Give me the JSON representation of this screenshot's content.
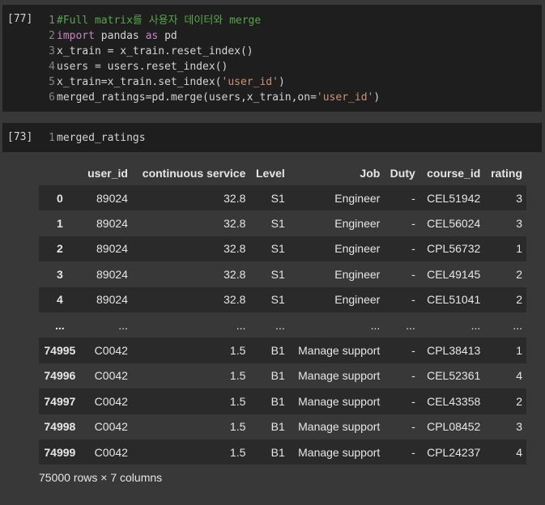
{
  "cells": [
    {
      "execution_count": "[77]",
      "lines": [
        {
          "number": "1",
          "tokens": [
            {
              "type": "comment",
              "text": "#Full matrix를 사용자 데이터와 merge"
            }
          ]
        },
        {
          "number": "2",
          "tokens": [
            {
              "type": "keyword",
              "text": "import"
            },
            {
              "type": "plain",
              "text": " pandas "
            },
            {
              "type": "keyword",
              "text": "as"
            },
            {
              "type": "plain",
              "text": " pd"
            }
          ]
        },
        {
          "number": "3",
          "tokens": [
            {
              "type": "plain",
              "text": "x_train = x_train.reset_index()"
            }
          ]
        },
        {
          "number": "4",
          "tokens": [
            {
              "type": "plain",
              "text": "users = users.reset_index()"
            }
          ]
        },
        {
          "number": "5",
          "tokens": [
            {
              "type": "plain",
              "text": "x_train=x_train.set_index("
            },
            {
              "type": "string",
              "text": "'user_id'"
            },
            {
              "type": "plain",
              "text": ")"
            }
          ]
        },
        {
          "number": "6",
          "tokens": [
            {
              "type": "plain",
              "text": "merged_ratings=pd.merge(users,x_train,on="
            },
            {
              "type": "string",
              "text": "'user_id'"
            },
            {
              "type": "plain",
              "text": ")"
            }
          ]
        }
      ]
    },
    {
      "execution_count": "[73]",
      "lines": [
        {
          "number": "1",
          "tokens": [
            {
              "type": "plain",
              "text": "merged_ratings"
            }
          ]
        }
      ]
    }
  ],
  "dataframe": {
    "columns": [
      "",
      "user_id",
      "continuous service",
      "Level",
      "Job",
      "Duty",
      "course_id",
      "rating"
    ],
    "rows": [
      [
        "0",
        "89024",
        "32.8",
        "S1",
        "Engineer",
        "-",
        "CEL51942",
        "3"
      ],
      [
        "1",
        "89024",
        "32.8",
        "S1",
        "Engineer",
        "-",
        "CEL56024",
        "3"
      ],
      [
        "2",
        "89024",
        "32.8",
        "S1",
        "Engineer",
        "-",
        "CPL56732",
        "1"
      ],
      [
        "3",
        "89024",
        "32.8",
        "S1",
        "Engineer",
        "-",
        "CEL49145",
        "2"
      ],
      [
        "4",
        "89024",
        "32.8",
        "S1",
        "Engineer",
        "-",
        "CEL51041",
        "2"
      ],
      [
        "...",
        "...",
        "...",
        "...",
        "...",
        "...",
        "...",
        "..."
      ],
      [
        "74995",
        "C0042",
        "1.5",
        "B1",
        "Manage support",
        "-",
        "CPL38413",
        "1"
      ],
      [
        "74996",
        "C0042",
        "1.5",
        "B1",
        "Manage support",
        "-",
        "CEL52361",
        "4"
      ],
      [
        "74997",
        "C0042",
        "1.5",
        "B1",
        "Manage support",
        "-",
        "CEL43358",
        "2"
      ],
      [
        "74998",
        "C0042",
        "1.5",
        "B1",
        "Manage support",
        "-",
        "CPL08452",
        "3"
      ],
      [
        "74999",
        "C0042",
        "1.5",
        "B1",
        "Manage support",
        "-",
        "CPL24237",
        "4"
      ]
    ],
    "footer": "75000 rows × 7 columns"
  }
}
